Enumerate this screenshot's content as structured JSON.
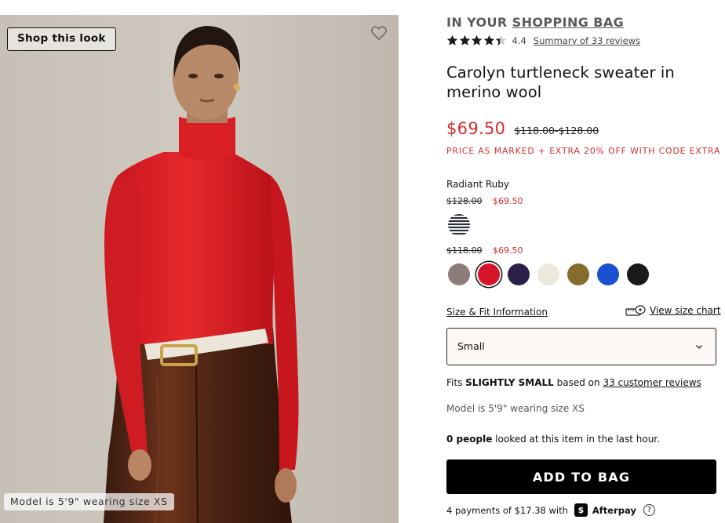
{
  "photo": {
    "shop_look_label": "Shop this look",
    "model_caption": "Model is 5'9\" wearing size XS"
  },
  "product": {
    "in_bag_prefix": "IN YOUR",
    "in_bag_link": "SHOPPING BAG",
    "rating": "4.4",
    "rating_stars": 4.4,
    "reviews_link": "Summary of 33 reviews",
    "title": "Carolyn turtleneck sweater in merino wool",
    "sale_price": "$69.50",
    "original_price": "$118.00-$128.00",
    "promo": "PRICE AS MARKED + EXTRA 20% OFF WITH CODE EXTRA",
    "color_name": "Radiant Ruby",
    "price_groups": [
      {
        "was": "$128.00",
        "now": "$69.50"
      },
      {
        "was": "$118.00",
        "now": "$69.50"
      }
    ],
    "swatch_colors": {
      "stripe": "#2b2f3a",
      "mauve": "#8d7c7a",
      "ruby": "#d8142b",
      "plum": "#2c1f48",
      "ivory": "#ece8dc",
      "olive": "#846c2c",
      "royal": "#1a4fd0",
      "black": "#1a1a1a"
    },
    "size_info_link": "Size & Fit Information",
    "size_chart_link": "View size chart",
    "size_selected": "Small",
    "fits_prefix": "Fits",
    "fits_strong": "SLIGHTLY SMALL",
    "fits_mid": "based on",
    "fits_link": "33 customer reviews",
    "model_line": "Model is 5'9\" wearing size XS",
    "people_strong": "0 people",
    "people_rest": "looked at this item in the last hour.",
    "add_to_bag": "ADD TO BAG",
    "afterpay_text": "4 payments of $17.38 with",
    "afterpay_badge": "$",
    "afterpay_name": "Afterpay",
    "help_glyph": "?"
  },
  "colors": {
    "sale_red": "#d22d2d",
    "button_black": "#000000"
  }
}
